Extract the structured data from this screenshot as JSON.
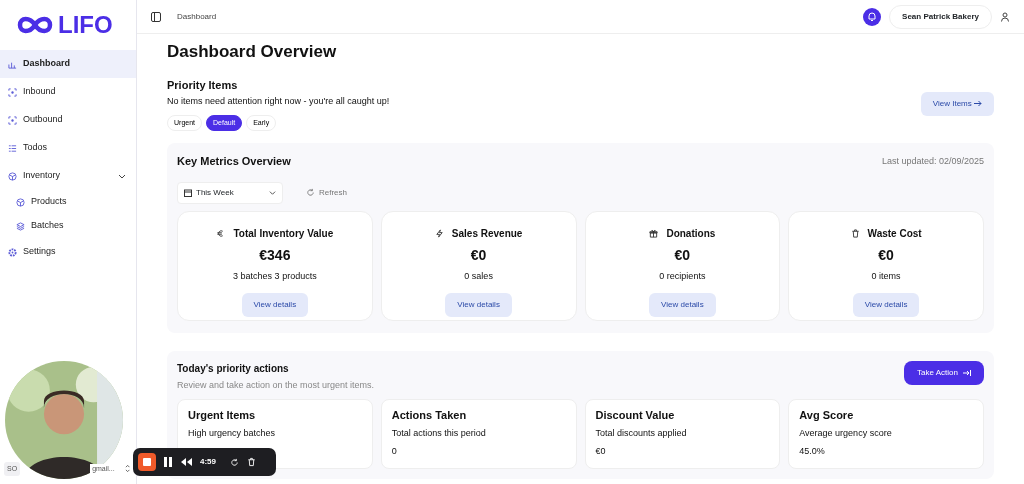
{
  "logo": {
    "text": "LIFO"
  },
  "sidebar": {
    "items": [
      {
        "label": "Dashboard",
        "selected": true
      },
      {
        "label": "Inbound",
        "selected": false
      },
      {
        "label": "Outbound",
        "selected": false
      },
      {
        "label": "Todos",
        "selected": false
      },
      {
        "label": "Inventory",
        "selected": false,
        "expanded": true,
        "children": [
          {
            "label": "Products",
            "selected": false
          },
          {
            "label": "Batches",
            "selected": false
          }
        ]
      },
      {
        "label": "Settings",
        "selected": false
      }
    ],
    "user": {
      "initials": "SO",
      "email": "gmail..."
    }
  },
  "header": {
    "breadcrumb": "Dashboard",
    "account": "Sean Patrick Bakery"
  },
  "page": {
    "title": "Dashboard Overview"
  },
  "priority": {
    "title": "Priority Items",
    "message": "No items need attention right now - you're all caught up!",
    "filters": [
      {
        "label": "Urgent",
        "selected": false
      },
      {
        "label": "Default",
        "selected": true
      },
      {
        "label": "Early",
        "selected": false
      }
    ],
    "button": "View Items"
  },
  "metrics": {
    "title": "Key Metrics Overview",
    "updated": "Last updated: 02/09/2025",
    "period": "This Week",
    "refresh": "Refresh",
    "cards": [
      {
        "title": "Total Inventory Value",
        "value": "€346",
        "sub": "3 batches  3 products",
        "button": "View details"
      },
      {
        "title": "Sales Revenue",
        "value": "€0",
        "sub": "0 sales",
        "button": "View details"
      },
      {
        "title": "Donations",
        "value": "€0",
        "sub": "0 recipients",
        "button": "View details"
      },
      {
        "title": "Waste Cost",
        "value": "€0",
        "sub": "0 items",
        "button": "View details"
      }
    ]
  },
  "actions": {
    "title": "Today's priority actions",
    "subtitle": "Review and take action on the most urgent items.",
    "button": "Take Action",
    "cards": [
      {
        "title": "Urgent Items",
        "sub": "High urgency batches"
      },
      {
        "title": "Actions Taken",
        "sub": "Total actions this period",
        "value": "0"
      },
      {
        "title": "Discount Value",
        "sub": "Total discounts applied",
        "value": "€0"
      },
      {
        "title": "Avg Score",
        "sub": "Average urgency score",
        "value": "45.0%"
      }
    ]
  },
  "recorder": {
    "time": "4:59"
  }
}
